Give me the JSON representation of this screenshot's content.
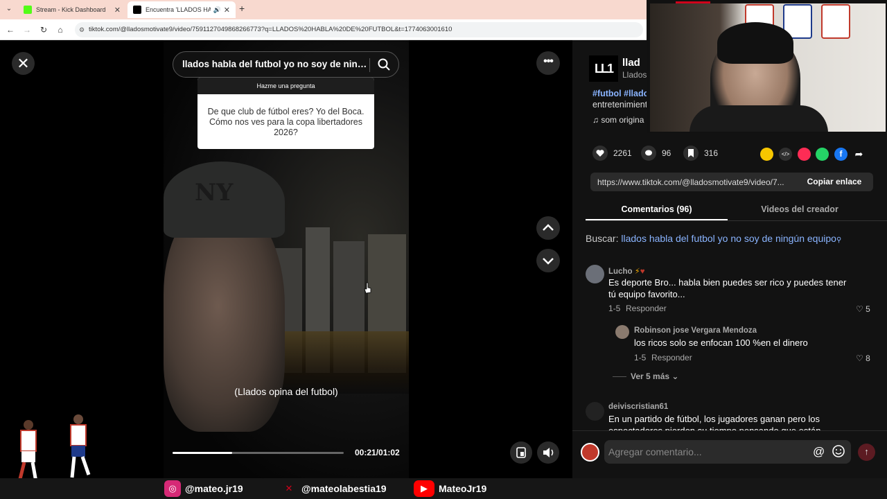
{
  "browser": {
    "tabs": [
      {
        "label": "Stream - Kick Dashboard",
        "icon": "kick-icon"
      },
      {
        "label": "Encuentra 'LLADOS HABLA",
        "icon": "tiktok-icon",
        "active": true
      }
    ],
    "new_tab": "+",
    "url": "tiktok.com/@lladosmotivate9/video/7591127049868266773?q=LLADOS%20HABLA%20DE%20FUTBOL&t=1774063001610"
  },
  "video": {
    "search_query": "llados habla del futbol yo no soy de ning...",
    "question_card": {
      "header": "Hazme una pregunta",
      "text": "De que club de fútbol eres? Yo del Boca. Cómo nos ves para la copa libertadores 2026?"
    },
    "subtitle": "(Llados opina del futbol)",
    "time": "00:21/01:02",
    "progress": 0.35
  },
  "panel": {
    "author_avatar": "LL1",
    "author_name": "llad",
    "author_sub": "Llados",
    "tags": "#futbol #llado",
    "description": "entretenimient",
    "music": "♫  som origina",
    "actions": {
      "likes": "2261",
      "comments": "96",
      "saves": "316"
    },
    "share_colors": [
      "#f7c600",
      "#2f2f2f",
      "#fe2c55",
      "#25d366",
      "#1877f2"
    ],
    "link": {
      "url": "https://www.tiktok.com/@lladosmotivate9/video/7...",
      "button": "Copiar enlace"
    },
    "tabs": {
      "comments": "Comentarios (96)",
      "videos": "Videos del creador"
    },
    "search_prefix": "Buscar:",
    "search_suggest": "llados habla del futbol yo no soy de ningún equipo",
    "comments": [
      {
        "user": "Lucho",
        "text": "Es deporte Bro... habla bien puedes ser rico y puedes tener tú equipo favorito...",
        "date": "1-5",
        "reply": "Responder",
        "likes": "5"
      },
      {
        "user": "Robinson jose Vergara Mendoza",
        "text": "los ricos solo se enfocan 100 %en el dinero",
        "date": "1-5",
        "reply": "Responder",
        "likes": "8"
      },
      {
        "user": "deiviscristian61",
        "text": "En un partido de fútbol, los jugadores ganan pero los espectadores pierden su tiempo pensando que están"
      }
    ],
    "more_replies": "Ver 5 más",
    "composer_placeholder": "Agregar comentario...",
    "at_symbol": "@"
  },
  "social": [
    {
      "handle": "@mateo.jr19",
      "icon": "instagram-icon",
      "color": "#d62976"
    },
    {
      "handle": "@mateolabestia19",
      "icon": "x-icon",
      "color": "#d0021b"
    },
    {
      "handle": "MateoJr19",
      "icon": "youtube-icon",
      "color": "#ff0000"
    }
  ]
}
